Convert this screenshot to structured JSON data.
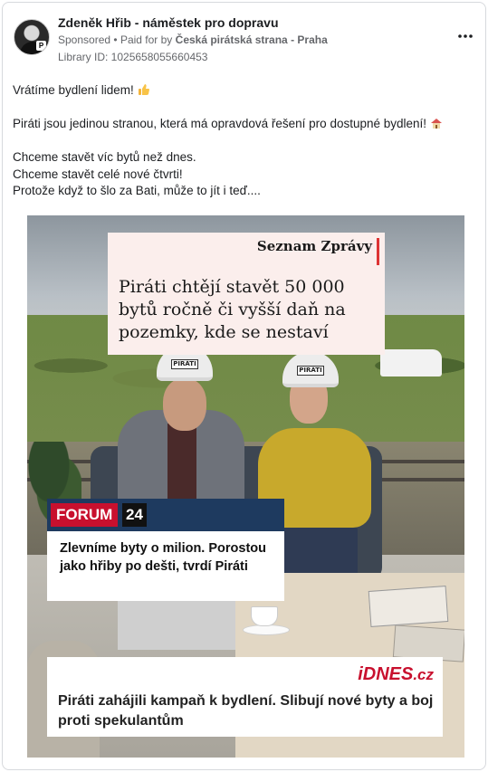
{
  "post": {
    "page_name": "Zdeněk Hřib - náměstek pro dopravu",
    "sponsored": "Sponsored",
    "separator": "•",
    "paid_for_prefix": "Paid for by",
    "paid_for_by": "Česká pirátská strana - Praha",
    "library_id": "Library ID: 1025658055660453",
    "more_icon": "more-horizontal-icon"
  },
  "body": {
    "line1": "Vrátíme bydlení lidem!",
    "line1_emoji": "thumbs-up-emoji",
    "line2": "Piráti jsou jedinou stranou, která má opravdová řešení pro dostupné bydlení!",
    "line2_emoji": "house-emoji",
    "line3": "Chceme stavět víc bytů než dnes.",
    "line4": "Chceme stavět celé nové čtvrti!",
    "line5": "Protože když to šlo za Bati, může to jít i teď...."
  },
  "media": {
    "hat_label": "PIRÁTI",
    "seznam": {
      "logo": "Seznam Zprávy",
      "headline": "Piráti chtějí stavět 50 000 bytů ročně či vyšší daň na pozemky, kde se nestaví"
    },
    "forum": {
      "logo_text": "FORUM",
      "logo_number": "24",
      "headline": "Zlevníme byty o milion. Porostou jako hřiby po dešti, tvrdí Piráti"
    },
    "idnes": {
      "logo": "iDNES",
      "logo_suffix": ".cz",
      "headline": "Piráti zahájili kampaň k bydlení. Slibují nové byty a boj proti spekulantům"
    }
  },
  "colors": {
    "forum_red": "#c8102e",
    "forum_navy": "#1e3a5f",
    "idnes_red": "#c8102e",
    "text_secondary": "#65676b"
  }
}
